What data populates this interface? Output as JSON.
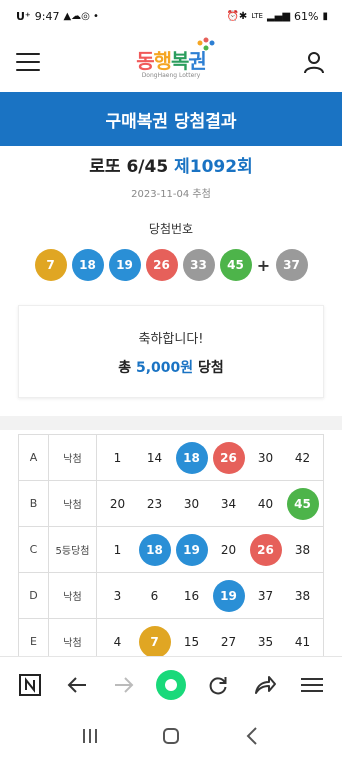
{
  "status_bar": {
    "time": "9:47",
    "carrier": "U⁺",
    "network": "LTE",
    "battery": "61%"
  },
  "header": {
    "logo_text": "동행복권",
    "logo_sub": "DongHaeng Lottery"
  },
  "banner": {
    "title": "구매복권 당첨결과"
  },
  "draw": {
    "game": "로또 6/45",
    "round": "제1092회",
    "date": "2023-11-04 추첨",
    "winning_label": "당첨번호",
    "numbers": [
      "7",
      "18",
      "19",
      "26",
      "33",
      "45"
    ],
    "plus": "+",
    "bonus": "37"
  },
  "result": {
    "congrats": "축하합니다!",
    "prize_prefix": "총",
    "prize_amount": "5,000원",
    "prize_suffix": "당첨"
  },
  "ticket": {
    "rows": [
      {
        "letter": "A",
        "rank": "낙첨",
        "numbers": [
          "1",
          "14",
          "18",
          "26",
          "30",
          "42"
        ]
      },
      {
        "letter": "B",
        "rank": "낙첨",
        "numbers": [
          "20",
          "23",
          "30",
          "34",
          "40",
          "45"
        ]
      },
      {
        "letter": "C",
        "rank": "5등당첨",
        "numbers": [
          "1",
          "18",
          "19",
          "20",
          "26",
          "38"
        ]
      },
      {
        "letter": "D",
        "rank": "낙첨",
        "numbers": [
          "3",
          "6",
          "16",
          "19",
          "37",
          "38"
        ]
      },
      {
        "letter": "E",
        "rank": "낙첨",
        "numbers": [
          "4",
          "7",
          "15",
          "27",
          "35",
          "41"
        ]
      }
    ]
  },
  "ball_colors": {
    "yellow": "#e0a623",
    "blue": "#2a8fd6",
    "red": "#e6605a",
    "gray": "#9a9a9a",
    "green": "#4db44a"
  },
  "icons": {
    "menu": "hamburger-icon",
    "user": "user-icon",
    "browser": [
      "naver-n-icon",
      "back-arrow-icon",
      "forward-arrow-icon",
      "home-dot-icon",
      "refresh-icon",
      "share-icon",
      "more-menu-icon"
    ],
    "system_nav": [
      "recent-apps-icon",
      "home-icon",
      "back-icon"
    ]
  }
}
